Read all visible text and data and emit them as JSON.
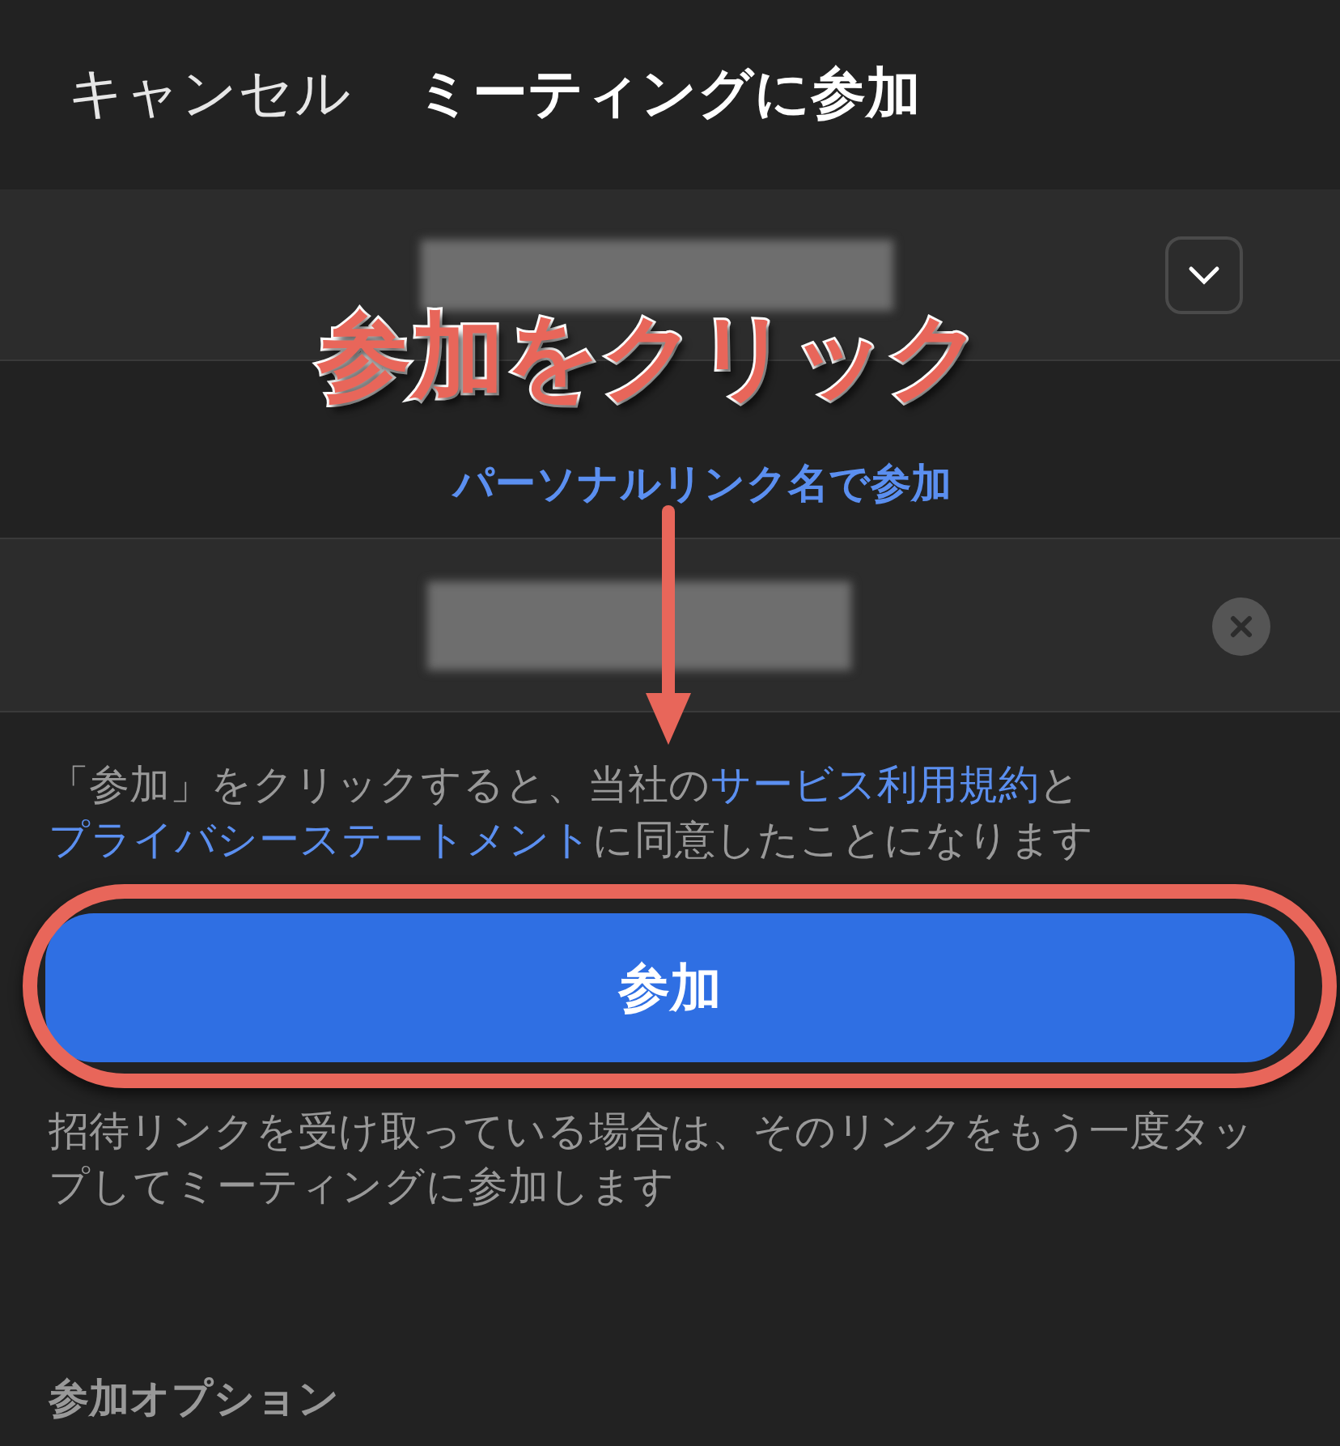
{
  "header": {
    "cancel": "キャンセル",
    "title": "ミーティングに参加"
  },
  "meeting_id_field": {
    "kind": "blurred"
  },
  "personal_link": "パーソナルリンク名で参加",
  "name_field": {
    "kind": "blurred"
  },
  "terms": {
    "before": "「参加」をクリックすると、当社の",
    "link1": "サービス利用規約",
    "middle": "と",
    "link2": "プライバシーステートメント",
    "after": "に同意したことになります"
  },
  "join_button": "参加",
  "invite_hint": "招待リンクを受け取っている場合は、そのリンクをもう一度タップしてミーティングに参加します",
  "section_title": "参加オプション",
  "annotation": {
    "text": "参加をクリック"
  }
}
